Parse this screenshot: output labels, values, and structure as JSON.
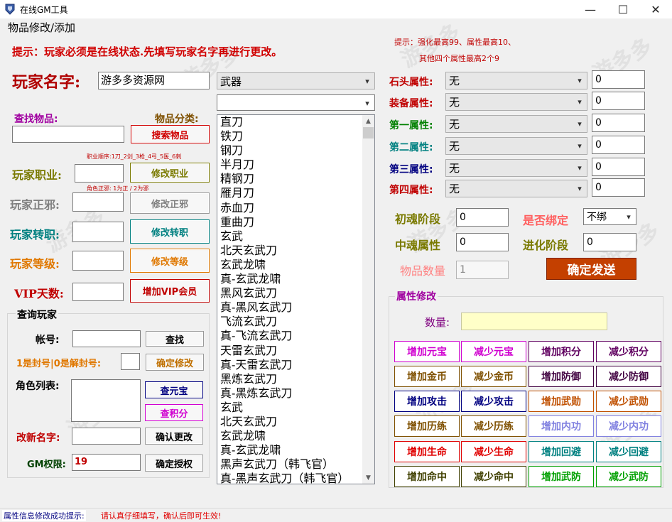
{
  "window": {
    "title": "在线GM工具",
    "minimize": "—",
    "maximize": "☐",
    "close": "✕"
  },
  "menu": {
    "label": "物品修改/添加"
  },
  "tips": {
    "online": "提示：玩家必须是在线状态.先填写玩家名字再进行更改。",
    "enhance_line1": "提示：强化最高99、属性最高10、",
    "enhance_line2": "其他四个属性最高2个9"
  },
  "player": {
    "label": "玩家名字:",
    "value": "游多多资源网"
  },
  "category": {
    "selected": "武器",
    "sub_selected": ""
  },
  "search": {
    "find_label": "查找物品:",
    "class_label": "物品分类:",
    "button": "搜索物品"
  },
  "hints": {
    "job_order": "职业顺序:1刀_2剑_3枪_4弓_5医_6刺",
    "alignment": "角色正邪: 1为正  / 2为邪"
  },
  "rows": {
    "job": {
      "label": "玩家职业:",
      "button": "修改职业",
      "color": "#7a7a00"
    },
    "alignment": {
      "label": "玩家正邪:",
      "button": "修改正邪",
      "color": "#7f7f7f"
    },
    "rebirth": {
      "label": "玩家转职:",
      "button": "修改转职",
      "color": "#008080"
    },
    "level": {
      "label": "玩家等级:",
      "button": "修改等级",
      "color": "#e07800"
    },
    "vip": {
      "label": "VIP天数:",
      "button": "增加VIP会员",
      "color": "#c00000"
    }
  },
  "query": {
    "title": "查询玩家",
    "account_label": "帐号:",
    "find_button": "查找",
    "ban_label": "1是封号|0是解封号:",
    "ban_button": "确定修改",
    "roles_label": "角色列表:",
    "yuanbao_button": "查元宝",
    "points_button": "查积分",
    "rename_label": "改新名字:",
    "rename_button": "确认更改",
    "gm_label": "GM权限:",
    "gm_value": "19",
    "gm_button": "确定授权"
  },
  "items": [
    "直刀",
    "铁刀",
    "钢刀",
    "半月刀",
    "精钢刀",
    "雁月刀",
    "赤血刀",
    "重曲刀",
    "玄武",
    "北天玄武刀",
    "玄武龙啸",
    "真-玄武龙啸",
    "黑风玄武刀",
    "真-黑风玄武刀",
    "飞流玄武刀",
    "真-飞流玄武刀",
    "天雷玄武刀",
    "真-天雷玄武刀",
    "黑炼玄武刀",
    "真-黑炼玄武刀",
    "玄武",
    "北天玄武刀",
    "玄武龙啸",
    "真-玄武龙啸",
    "黑声玄武刀（韩飞官）",
    "真-黑声玄武刀（韩飞官）"
  ],
  "attributes": [
    {
      "label": "石头属性:",
      "value": "无",
      "num": "0",
      "color": "#c00000"
    },
    {
      "label": "装备属性:",
      "value": "无",
      "num": "0",
      "color": "#c00000"
    },
    {
      "label": "第一属性:",
      "value": "无",
      "num": "0",
      "color": "#008000"
    },
    {
      "label": "第二属性:",
      "value": "无",
      "num": "0",
      "color": "#008080"
    },
    {
      "label": "第三属性:",
      "value": "无",
      "num": "0",
      "color": "#000080"
    },
    {
      "label": "第四属性:",
      "value": "无",
      "num": "0",
      "color": "#c00000"
    }
  ],
  "soul": {
    "initial_label": "初魂阶段",
    "initial_value": "0",
    "bind_label": "是否绑定",
    "bind_value": "不绑",
    "mid_label": "中魂属性",
    "mid_value": "0",
    "evolve_label": "进化阶段",
    "evolve_value": "0",
    "qty_label": "物品数量",
    "qty_value": "1",
    "send_button": "确定发送"
  },
  "modify": {
    "title": "属性修改",
    "qty_label": "数量:",
    "qty_value": "",
    "buttons": [
      {
        "label": "增加元宝",
        "color": "#d000d0"
      },
      {
        "label": "减少元宝",
        "color": "#d000d0"
      },
      {
        "label": "增加积分",
        "color": "#600060"
      },
      {
        "label": "减少积分",
        "color": "#600060"
      },
      {
        "label": "增加金币",
        "color": "#7f5000"
      },
      {
        "label": "减少金币",
        "color": "#7f5000"
      },
      {
        "label": "增加防御",
        "color": "#400040"
      },
      {
        "label": "减少防御",
        "color": "#400040"
      },
      {
        "label": "增加攻击",
        "color": "#000080"
      },
      {
        "label": "减少攻击",
        "color": "#000080"
      },
      {
        "label": "增加武勋",
        "color": "#c05000"
      },
      {
        "label": "减少武勋",
        "color": "#c05000"
      },
      {
        "label": "增加历练",
        "color": "#7f5000"
      },
      {
        "label": "减少历练",
        "color": "#7f5000"
      },
      {
        "label": "增加内功",
        "color": "#8080e0"
      },
      {
        "label": "减少内功",
        "color": "#8080e0"
      },
      {
        "label": "增加生命",
        "color": "#e00000"
      },
      {
        "label": "减少生命",
        "color": "#e00000"
      },
      {
        "label": "增加回避",
        "color": "#008080"
      },
      {
        "label": "减少回避",
        "color": "#008080"
      },
      {
        "label": "增加命中",
        "color": "#404000"
      },
      {
        "label": "减少命中",
        "color": "#404000"
      },
      {
        "label": "增加武防",
        "color": "#00a000"
      },
      {
        "label": "减少武防",
        "color": "#00a000"
      }
    ]
  },
  "statusbar": {
    "left": "属性信息修改成功提示:",
    "right": "请认真仔细填写，确认后即可生效!"
  },
  "watermark": {
    "text": "游多多"
  }
}
